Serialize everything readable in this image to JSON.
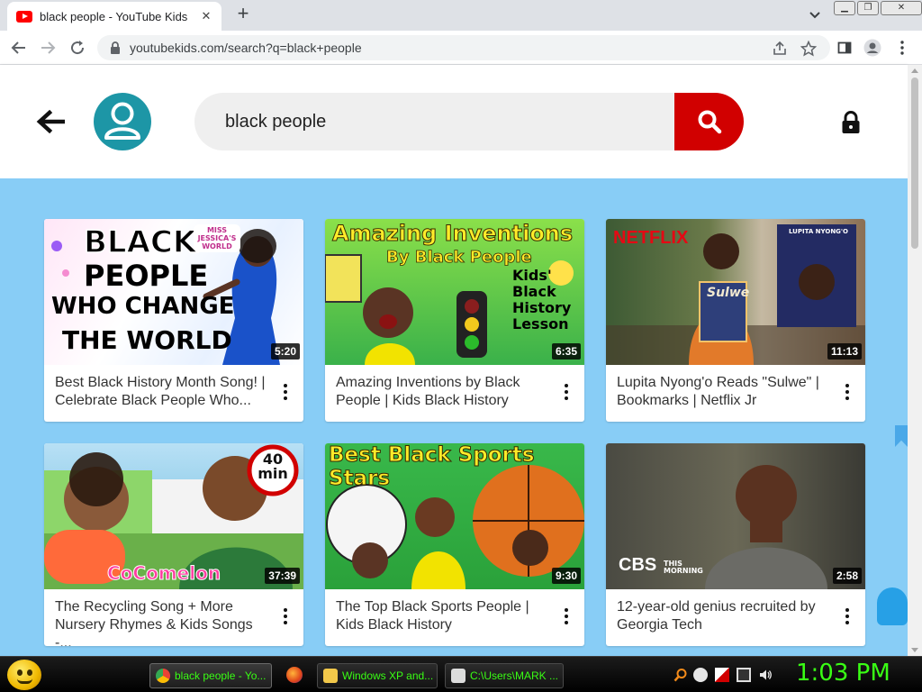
{
  "browser": {
    "tab_title": "black people - YouTube Kids",
    "tab_close": "✕",
    "new_tab": "+",
    "url": "youtubekids.com/search?q=black+people",
    "window_buttons": [
      "▁",
      "❐",
      "✕"
    ]
  },
  "header": {
    "search_value": "black people",
    "search_placeholder": "Search"
  },
  "videos": [
    {
      "title": "Best Black History Month Song! | Celebrate Black People Who...",
      "duration": "5:20",
      "thumb_text": [
        "BLACK",
        "PEOPLE",
        "WHO CHANGE",
        "THE WORLD"
      ],
      "thumb_badge": "MISS JESSICA'S WORLD"
    },
    {
      "title": "Amazing Inventions by Black People | Kids Black History",
      "duration": "6:35",
      "thumb_text": [
        "Amazing Inventions",
        "By Black People"
      ],
      "thumb_badge": "Kids' Black History Lesson"
    },
    {
      "title": "Lupita Nyong'o Reads \"Sulwe\" | Bookmarks | Netflix Jr",
      "duration": "11:13",
      "thumb_text": [
        "NETFLIX",
        "Sulwe"
      ],
      "thumb_badge": "LUPITA NYONG'O"
    },
    {
      "title": "The Recycling Song + More Nursery Rhymes & Kids Songs -...",
      "duration": "37:39",
      "thumb_text": [
        "CoComelon"
      ],
      "thumb_badge": "40 min"
    },
    {
      "title": "The Top Black Sports People | Kids Black History",
      "duration": "9:30",
      "thumb_text": [
        "Best Black Sports Stars"
      ],
      "thumb_badge": ""
    },
    {
      "title": "12-year-old genius recruited by Georgia Tech",
      "duration": "2:58",
      "thumb_text": [
        "CBS",
        "THIS MORNING"
      ],
      "thumb_badge": ""
    }
  ],
  "taskbar": {
    "tasks": [
      "black people - Yo...",
      "Windows XP and...",
      "C:\\Users\\MARK ..."
    ],
    "clock": "1:03 PM"
  },
  "colors": {
    "content_bg": "#88cdf6",
    "search_button": "#d10000",
    "avatar": "#1d96a6",
    "taskbar_text": "#39ff14"
  }
}
